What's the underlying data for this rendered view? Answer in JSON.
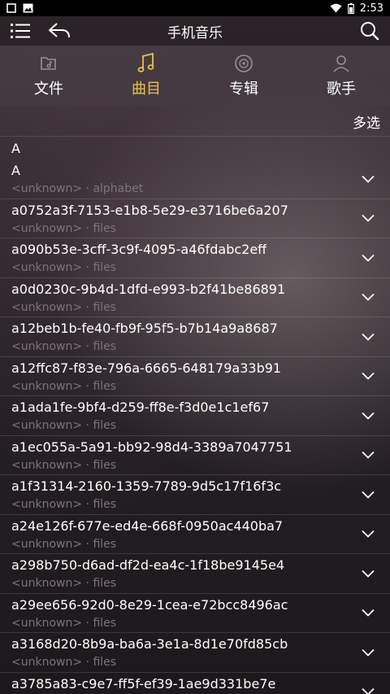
{
  "status_bar": {
    "time": "2:53"
  },
  "header": {
    "title": "手机音乐"
  },
  "tabs": [
    {
      "label": "文件",
      "icon": "folder-music-icon",
      "active": false
    },
    {
      "label": "曲目",
      "icon": "music-note-icon",
      "active": true
    },
    {
      "label": "专辑",
      "icon": "disc-icon",
      "active": false
    },
    {
      "label": "歌手",
      "icon": "person-icon",
      "active": false
    }
  ],
  "multi_select_label": "多选",
  "section_letter": "A",
  "tracks": [
    {
      "title": "A",
      "artist": "<unknown>",
      "separator": "·",
      "album": "alphabet"
    },
    {
      "title": "a0752a3f-7153-e1b8-5e29-e3716be6a207",
      "artist": "<unknown>",
      "separator": "·",
      "album": "files"
    },
    {
      "title": "a090b53e-3cff-3c9f-4095-a46fdabc2eff",
      "artist": "<unknown>",
      "separator": "·",
      "album": "files"
    },
    {
      "title": "a0d0230c-9b4d-1dfd-e993-b2f41be86891",
      "artist": "<unknown>",
      "separator": "·",
      "album": "files"
    },
    {
      "title": "a12beb1b-fe40-fb9f-95f5-b7b14a9a8687",
      "artist": "<unknown>",
      "separator": "·",
      "album": "files"
    },
    {
      "title": "a12ffc87-f83e-796a-6665-648179a33b91",
      "artist": "<unknown>",
      "separator": "·",
      "album": "files"
    },
    {
      "title": "a1ada1fe-9bf4-d259-ff8e-f3d0e1c1ef67",
      "artist": "<unknown>",
      "separator": "·",
      "album": "files"
    },
    {
      "title": "a1ec055a-5a91-bb92-98d4-3389a7047751",
      "artist": "<unknown>",
      "separator": "·",
      "album": "files"
    },
    {
      "title": "a1f31314-2160-1359-7789-9d5c17f16f3c",
      "artist": "<unknown>",
      "separator": "·",
      "album": "files"
    },
    {
      "title": "a24e126f-677e-ed4e-668f-0950ac440ba7",
      "artist": "<unknown>",
      "separator": "·",
      "album": "files"
    },
    {
      "title": "a298b750-d6ad-df2d-ea4c-1f18be9145e4",
      "artist": "<unknown>",
      "separator": "·",
      "album": "files"
    },
    {
      "title": "a29ee656-92d0-8e29-1cea-e72bcc8496ac",
      "artist": "<unknown>",
      "separator": "·",
      "album": "files"
    },
    {
      "title": "a3168d20-8b9a-ba6a-3e1a-8d1e70fd85cb",
      "artist": "<unknown>",
      "separator": "·",
      "album": "files"
    },
    {
      "title": "a3785a83-c9e7-ff5f-ef39-1ae9d331be7e",
      "artist": "",
      "separator": "",
      "album": ""
    }
  ],
  "colors": {
    "accent": "#e8c24a",
    "subtext": "#7c7478"
  }
}
